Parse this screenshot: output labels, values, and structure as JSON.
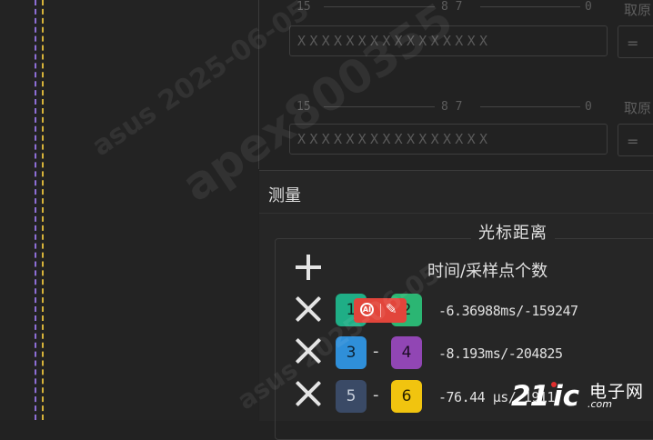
{
  "bit_rows": [
    {
      "labels": [
        "15",
        "8 7",
        "0"
      ],
      "field": "XXXXXXXXXXXXXXXX",
      "side_label": "取原"
    },
    {
      "labels": [
        "15",
        "8 7",
        "0"
      ],
      "field": "XXXXXXXXXXXXXXXX",
      "side_label": "取原"
    }
  ],
  "side_glyph": "=",
  "measure": {
    "title": "测量",
    "group_title": "光标距离",
    "column_header": "时间/采样点个数",
    "rows": [
      {
        "from": "1",
        "to": "2",
        "from_color": "#1fae86",
        "to_color": "#2bb673",
        "value": "-6.36988ms/-159247"
      },
      {
        "from": "3",
        "to": "4",
        "from_color": "#2f8fd9",
        "to_color": "#9146b4",
        "value": "-8.193ms/-204825"
      },
      {
        "from": "5",
        "to": "6",
        "from_color": "#3a4a66",
        "to_color": "#f1c40f",
        "value": "-76.44 μs/-1911"
      }
    ],
    "dash": "-"
  },
  "ai_badge": {
    "label": "AI",
    "wand": "✎"
  },
  "watermarks": {
    "text1": "asus 2025-06-05",
    "text2": "apex800355",
    "text3": "asus 2025-06-05"
  },
  "logo": {
    "part1": "21",
    "part2": "ic",
    "cn": "电子网",
    "com": ".com"
  },
  "colors": {
    "line_purple": "#8e6fd6",
    "line_yellow": "#d6b23a"
  }
}
